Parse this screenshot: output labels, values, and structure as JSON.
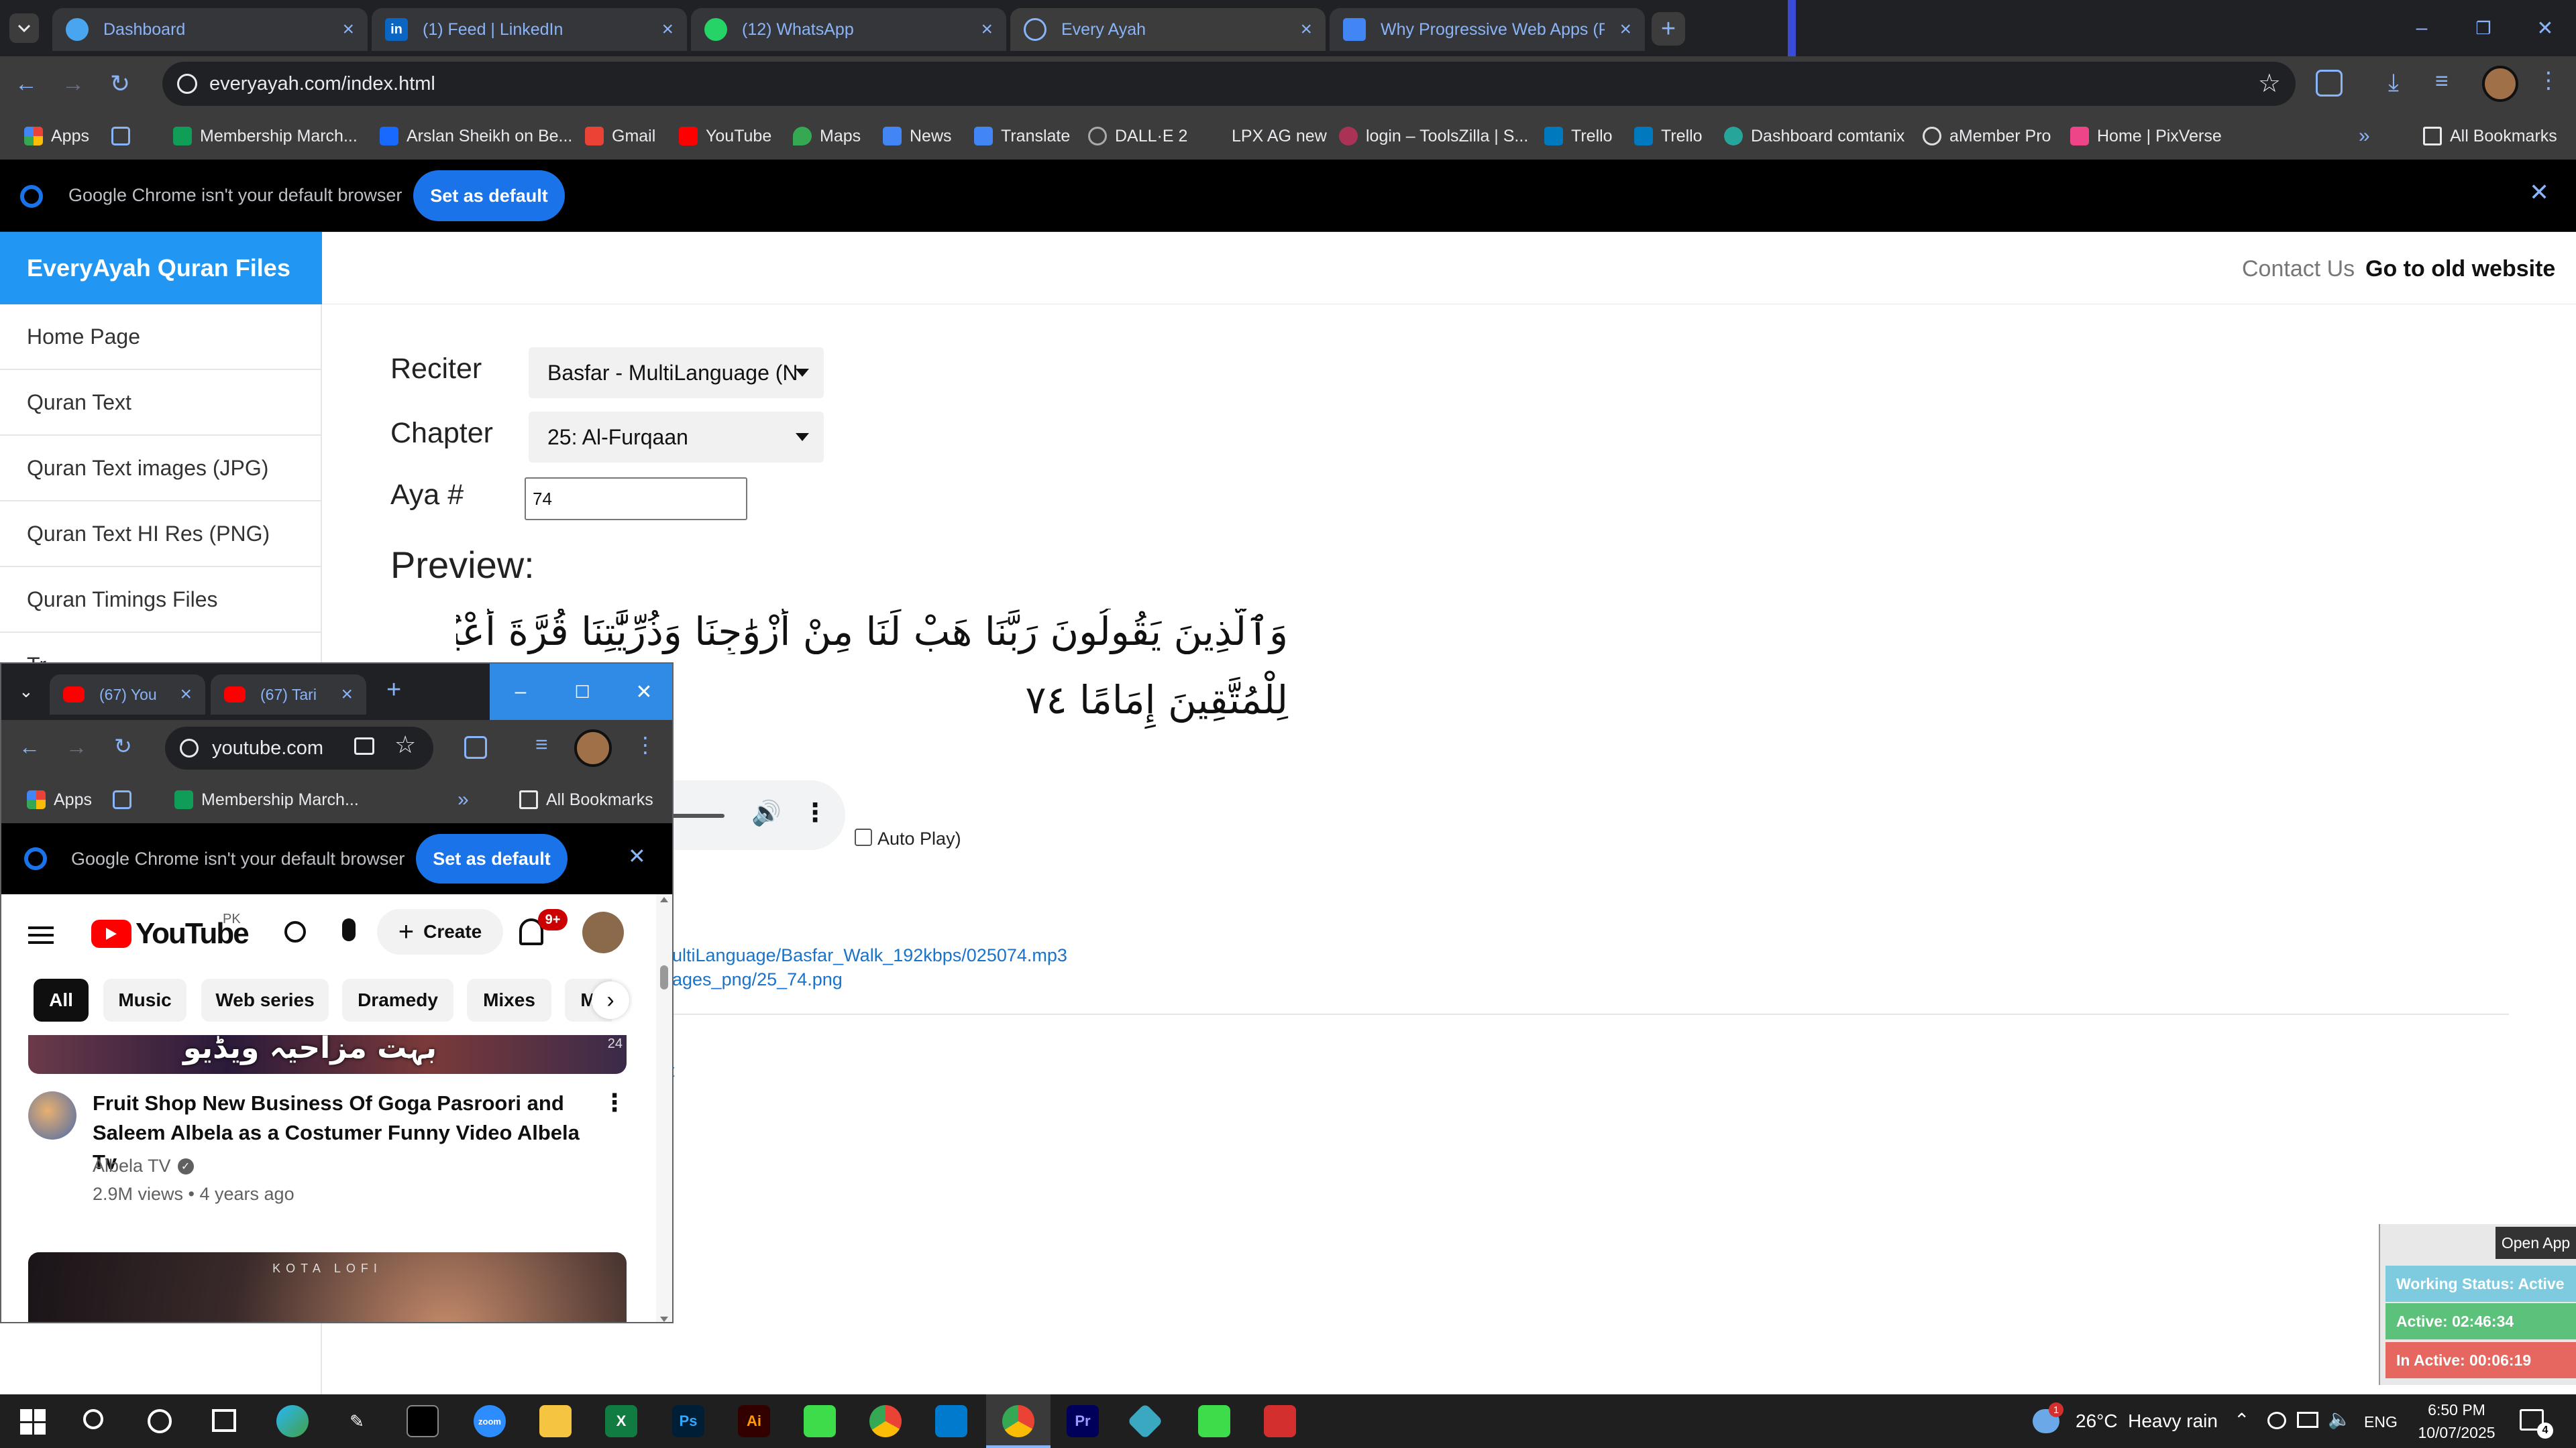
{
  "browser": {
    "tabs": [
      {
        "title": "Dashboard",
        "favicon_color": "#4aa5f0"
      },
      {
        "title": "(1) Feed | LinkedIn",
        "favicon_color": "#0a66c2"
      },
      {
        "title": "(12) WhatsApp",
        "favicon_color": "#25d366"
      },
      {
        "title": "Every Ayah",
        "favicon_color": "#8ab4f8"
      },
      {
        "title": "Why Progressive Web Apps (PV",
        "favicon_color": "#4285f4"
      }
    ],
    "url": "everyayah.com/index.html",
    "bookmarks": [
      {
        "label": "Apps",
        "icon_color": "#4285f4"
      },
      {
        "label": "",
        "icon_color": "#8ab4f8"
      },
      {
        "label": "Membership March...",
        "icon_color": "#0f9d58"
      },
      {
        "label": "Arslan Sheikh on Be...",
        "icon_color": "#1769ff"
      },
      {
        "label": "Gmail",
        "icon_color": "#ea4335"
      },
      {
        "label": "YouTube",
        "icon_color": "#ff0000"
      },
      {
        "label": "Maps",
        "icon_color": "#34a853"
      },
      {
        "label": "News",
        "icon_color": "#4285f4"
      },
      {
        "label": "Translate",
        "icon_color": "#4285f4"
      },
      {
        "label": "DALL·E 2",
        "icon_color": "#888888"
      },
      {
        "label": "LPX AG new",
        "icon_color": "#3c3c3c"
      },
      {
        "label": "login – ToolsZilla | S...",
        "icon_color": "#aa3355"
      },
      {
        "label": "Trello",
        "icon_color": "#0079bf"
      },
      {
        "label": "Trello",
        "icon_color": "#0079bf"
      },
      {
        "label": "Dashboard comtanix",
        "icon_color": "#26a69a"
      },
      {
        "label": "aMember Pro",
        "icon_color": "#bbbbbb"
      },
      {
        "label": "Home | PixVerse",
        "icon_color": "#ee4488"
      }
    ],
    "all_bookmarks": "All Bookmarks",
    "default_banner": {
      "text": "Google Chrome isn't your default browser",
      "button": "Set as default"
    }
  },
  "site": {
    "brand": "EveryAyah Quran Files",
    "header_links": {
      "contact": "Contact Us",
      "old_site": "Go to old website"
    },
    "sidebar": [
      "Home Page",
      "Quran Text",
      "Quran Text images (JPG)",
      "Quran Text HI Res (PNG)",
      "Quran Timings Files",
      "Tr"
    ],
    "form": {
      "reciter_label": "Reciter",
      "reciter_value": "Basfar - MultiLanguage (N",
      "chapter_label": "Chapter",
      "chapter_value": "25: Al-Furqaan",
      "aya_label": "Aya #",
      "aya_value": "74"
    },
    "preview_label": "Preview:",
    "arabic_line1": "وَٱلَّذِينَ يَقُولُونَ رَبَّنَا هَبْ لَنَا مِنْ أَزْوَٰجِنَا وَذُرِّيَّٰتِنَا قُرَّةَ أَعْيُنٍ وَٱجْعَلْنَا",
    "arabic_line2": "لِلْمُتَّقِينَ إِمَامًا ٧٤",
    "autoplay_label": "Auto Play)",
    "links": {
      "audio": "ultiLanguage/Basfar_Walk_192kbps/025074.mp3",
      "image": "ages_png/25_74.png",
      "partial": "t"
    }
  },
  "yt_window": {
    "tabs": [
      {
        "title": "(67) You"
      },
      {
        "title": "(67) Tari"
      }
    ],
    "url": "youtube.com",
    "bookmarks": {
      "apps": "Apps",
      "membership": "Membership March...",
      "all": "All Bookmarks"
    },
    "banner": {
      "text": "Google Chrome isn't your default browser",
      "button": "Set as default"
    },
    "header": {
      "logo": "YouTube",
      "region": "PK",
      "create": "Create",
      "notif_count": "9+"
    },
    "chips": [
      "All",
      "Music",
      "Web series",
      "Dramedy",
      "Mixes",
      "M"
    ],
    "thumb_text": "بہت مزاحیہ ویڈیو",
    "thumb_duration": "24",
    "video": {
      "title_line1": "Fruit Shop New Business Of Goga Pasroori and",
      "title_line2": "Saleem Albela as a Costumer Funny Video Albela Tv",
      "channel": "Albela TV",
      "meta": "2.9M views • 4 years ago"
    },
    "next_thumb_text": "KOTA LOFI"
  },
  "widget": {
    "open": "Open App",
    "status": "Working Status: Active",
    "active": "Active: 02:46:34",
    "inactive": "In Active: 00:06:19",
    "colors": {
      "status": "#7ecbe0",
      "active": "#5cc17a",
      "inactive": "#e5675f"
    }
  },
  "taskbar": {
    "apps": [
      "zoom",
      "Ps",
      "Ai",
      "Pr"
    ],
    "weather": "26°C  Heavy rain",
    "weather_badge": "1",
    "lang": "ENG",
    "time": "6:50 PM",
    "date": "10/07/2025",
    "notif": "4"
  }
}
